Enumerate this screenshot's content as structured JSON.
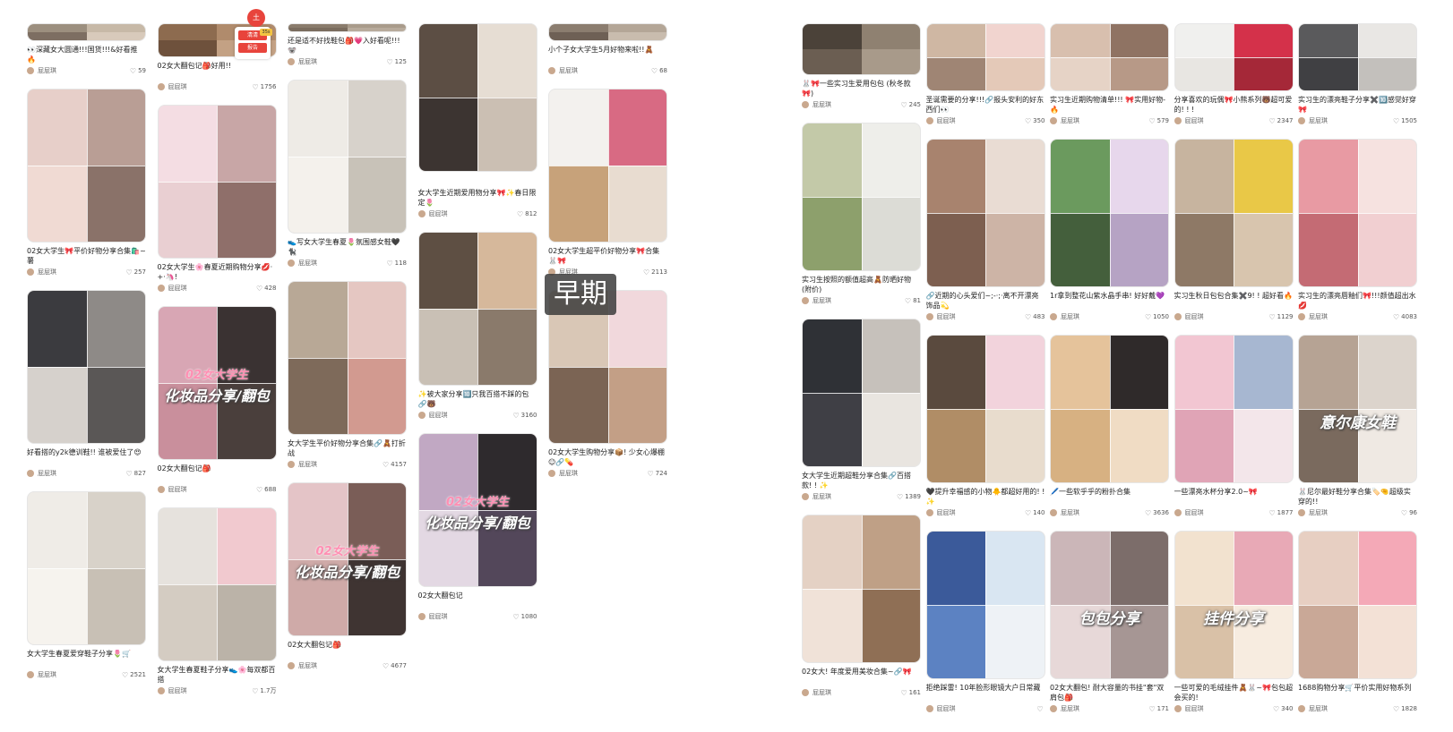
{
  "overlay_label": "早期",
  "floating_tools": {
    "fab": "土",
    "chip1": "清清",
    "chip2": "报告",
    "badge": "35s"
  },
  "colors": {
    "accent": "#e8443c",
    "overlay_bg": "#3c3c3c",
    "sticker_pink": "#ff8fb3"
  },
  "left_columns": [
    [
      {
        "title": "👀深藏女大圆通!!!国货!!!&好看推🔥",
        "author": "屁屁琪",
        "likes": "59",
        "h": 20,
        "tone": [
          "#9c8f7f",
          "#c7b9a7",
          "#7d6e62",
          "#d8cabb"
        ]
      },
      {
        "title": "02女大学生🎀平价好物分享合集🛍️~薯",
        "author": "屁屁琪",
        "likes": "257",
        "h": 172,
        "tone": [
          "#e7cfc9",
          "#b99e95",
          "#f0dad3",
          "#8a7269"
        ]
      },
      {
        "title": "好看搭的y2k德训鞋!! 谁被爱住了😍",
        "author": "屁屁琪",
        "likes": "827",
        "h": 172,
        "tone": [
          "#3b3b3f",
          "#8e8a87",
          "#d6d1cc",
          "#5a5756"
        ]
      },
      {
        "title": "女大学生春夏爱穿鞋子分享🌷🛒",
        "author": "屁屁琪",
        "likes": "2521",
        "h": 172,
        "tone": [
          "#efece7",
          "#d8d2c9",
          "#f6f3ee",
          "#c8c0b5"
        ]
      }
    ],
    [
      {
        "title": "02女大翻包记🎒好用!!",
        "author": "屁屁琪",
        "likes": "1756",
        "h": 38,
        "tone": [
          "#8d6b4f",
          "#b08b6c",
          "#6e513c",
          "#c3a184"
        ]
      },
      {
        "title": "02女大学生🌸春夏近期购物分享💋·+·🦄!",
        "author": "屁屁琪",
        "likes": "428",
        "h": 172,
        "tone": [
          "#f4dde3",
          "#c8a6a6",
          "#e9cfd2",
          "#8f6f6a"
        ]
      },
      {
        "title": "02女大翻包记🎒",
        "author": "屁屁琪",
        "likes": "688",
        "h": 172,
        "tone": [
          "#d8a6b4",
          "#3a3232",
          "#c98f9c",
          "#4a3f3c"
        ],
        "sticker": "02女大学生",
        "big": "化妆品分享/翻包"
      },
      {
        "title": "女大学生春夏鞋子分享👟🌸每双都百搭",
        "author": "屁屁琪",
        "likes": "1.7万",
        "h": 172,
        "tone": [
          "#e6e2dd",
          "#f1c9cf",
          "#d4ccc2",
          "#bbb3a8"
        ]
      }
    ],
    [
      {
        "title": "还是适不好找鞋包🎒💗入好看呢!!!🐨",
        "author": "屁屁琪",
        "likes": "125",
        "h": 10,
        "tone": [
          "#8a7c6c",
          "#a99b8b",
          "#7a6c5e",
          "#b8ab9c"
        ]
      },
      {
        "title": "👟写女大学生春夏🌷氛围感女鞋🖤🐈‍⬛",
        "author": "屁屁琪",
        "likes": "118",
        "h": 172,
        "tone": [
          "#eeebe6",
          "#d7d2cb",
          "#f4f1ec",
          "#c8c2b8"
        ]
      },
      {
        "title": "女大学生平价好物分享合集🔗🧸打折战",
        "author": "屁屁琪",
        "likes": "4157",
        "h": 172,
        "tone": [
          "#b8a896",
          "#e5c7c2",
          "#7e6a5a",
          "#d29a90"
        ]
      },
      {
        "title": "02女大翻包记🎒",
        "author": "屁屁琪",
        "likes": "4677",
        "h": 172,
        "tone": [
          "#e4c4c7",
          "#7a5d57",
          "#cfaaa8",
          "#3f3432"
        ],
        "sticker": "02女大学生",
        "big": "化妆品分享/翻包"
      }
    ],
    [
      {
        "title": "",
        "author": "",
        "likes": "",
        "h": 166,
        "tone": [
          "#5c4e44",
          "#e6ddd3",
          "#3c3431",
          "#cbbfb3"
        ]
      },
      {
        "title": "女大学生近期爱用物分享🎀✨春日限定🌷",
        "author": "屁屁琪",
        "likes": "812",
        "h": 0,
        "tone": []
      },
      {
        "title": "✨被大家分享🔟只我百搭不踩的包🔗🐻",
        "author": "屁屁琪",
        "likes": "3160",
        "h": 172,
        "tone": [
          "#5e4f43",
          "#d6b89b",
          "#c9c0b5",
          "#8a7a6b"
        ]
      },
      {
        "title": "02女大翻包记",
        "author": "屁屁琪",
        "likes": "1080",
        "h": 172,
        "tone": [
          "#c1a8c3",
          "#2e2a2d",
          "#e3d8e3",
          "#53475a"
        ],
        "sticker": "02女大学生",
        "big": "化妆品分享/翻包"
      }
    ],
    [
      {
        "title": "小个子女大学生5月好物来啦!!🧸",
        "author": "屁屁琪",
        "likes": "68",
        "h": 20,
        "tone": [
          "#8b7d6f",
          "#b4a697",
          "#6e6055",
          "#c9bcae"
        ]
      },
      {
        "title": "02女大学生超平价好物分享🎀合集🐰🎀",
        "author": "屁屁琪",
        "likes": "2113",
        "h": 172,
        "tone": [
          "#f3f1ee",
          "#d86a83",
          "#c7a27a",
          "#e8dcd0"
        ]
      },
      {
        "title": "02女大学生购物分享📦! 少女心爆棚☺🔗💊",
        "author": "屁屁琪",
        "likes": "724",
        "h": 172,
        "tone": [
          "#d9c7b6",
          "#f1d8dc",
          "#7b6454",
          "#c39f86"
        ]
      }
    ]
  ],
  "right_columns": [
    [
      {
        "title": "🐰🎀一些实习生爱用包包 (秋冬款🎀)",
        "author": "屁屁琪",
        "likes": "245",
        "h": 58,
        "tone": [
          "#4b4239",
          "#8f8171",
          "#6b5e52",
          "#a89a8a"
        ]
      },
      {
        "title": "实习生按照的额值超高🧸防晒好物 (附价)",
        "author": "屁屁琪",
        "likes": "81",
        "h": 166,
        "tone": [
          "#c3c9a8",
          "#eeeeea",
          "#8da06c",
          "#dcdcd6"
        ]
      },
      {
        "title": "女大学生近期超鞋分享合集🔗百搭款! ! ✨",
        "author": "屁屁琪",
        "likes": "1389",
        "h": 166,
        "tone": [
          "#2f3136",
          "#c6c1bb",
          "#3f3f45",
          "#e9e5e0"
        ]
      },
      {
        "title": "02女大! 年度爱用美妆合集~🔗🎀",
        "author": "屁屁琪",
        "likes": "161",
        "h": 166,
        "tone": [
          "#e4d1c4",
          "#bfa086",
          "#f0e2d8",
          "#8f6f55"
        ]
      }
    ],
    [
      {
        "title": "圣诞需要的分享!!!🔗报头安利的好东西们👀",
        "author": "屁屁琪",
        "likes": "350",
        "h": 76,
        "tone": [
          "#cfb7a3",
          "#f1d4cf",
          "#9f8574",
          "#e4c9b8"
        ]
      },
      {
        "title": "🔗近期的心头爱们~;-·;·离不开漂亮饰品💫",
        "author": "屁屁琪",
        "likes": "483",
        "h": 166,
        "tone": [
          "#a8836e",
          "#e9dcd3",
          "#7d5f50",
          "#cdb4a6"
        ]
      },
      {
        "title": "🖤提升幸福感的小物🐥都超好用的! ! ✨",
        "author": "屁屁琪",
        "likes": "140",
        "h": 166,
        "tone": [
          "#5a4a3e",
          "#f2d3dc",
          "#b08d66",
          "#e8dccd"
        ]
      },
      {
        "title": "拒绝踩雷! 10年脸形眼镜大户日常藏",
        "author": "屁屁琪",
        "likes": "",
        "h": 166,
        "tone": [
          "#3b5a9a",
          "#d9e6f2",
          "#5c82c2",
          "#eef2f6"
        ]
      }
    ],
    [
      {
        "title": "实习生近期购物清单!!! 🎀实用好物-🔥",
        "author": "屁屁琪",
        "likes": "579",
        "h": 76,
        "tone": [
          "#d8bfae",
          "#8f7363",
          "#e6d3c6",
          "#b79987"
        ]
      },
      {
        "title": "1r拿到整花山紫水晶手串! 好好戴💜",
        "author": "屁屁琪",
        "likes": "1050",
        "h": 166,
        "tone": [
          "#6b9a5e",
          "#e7d7ec",
          "#445f3c",
          "#b6a3c4"
        ]
      },
      {
        "title": "🖊️一些软乎乎的粉扑合集",
        "author": "屁屁琪",
        "likes": "3636",
        "h": 166,
        "tone": [
          "#e5c39b",
          "#2f2a2a",
          "#d7b182",
          "#f0dcc4"
        ]
      },
      {
        "title": "02女大翻包! 耐大容量的书挂\"套\"双肩包🎒",
        "author": "屁屁琪",
        "likes": "171",
        "h": 166,
        "tone": [
          "#cbb6b8",
          "#7c6d6a",
          "#e7d8d8",
          "#a69694"
        ],
        "big": "包包分享"
      }
    ],
    [
      {
        "title": "分享喜欢的玩偶🎀小熊系列🐻超可爱的! ! !",
        "author": "屁屁琪",
        "likes": "2347",
        "h": 76,
        "tone": [
          "#f0f0ee",
          "#d4314a",
          "#e8e6e2",
          "#a52838"
        ]
      },
      {
        "title": "实习生秋日包包合集✖️9! ! 超好看🔥",
        "author": "屁屁琪",
        "likes": "1129",
        "h": 166,
        "tone": [
          "#c7b49f",
          "#e9c847",
          "#8e7966",
          "#d8c5ae"
        ]
      },
      {
        "title": "一些漂亮水杯分享2.0~🎀",
        "author": "屁屁琪",
        "likes": "1877",
        "h": 166,
        "tone": [
          "#f2c6d2",
          "#a7b7d1",
          "#e0a4b6",
          "#f3e6ea"
        ]
      },
      {
        "title": "一些可爱的毛绒挂件🧸🐰~🎀包包超会买的!",
        "author": "屁屁琪",
        "likes": "340",
        "h": 166,
        "tone": [
          "#f2e2cf",
          "#e8a9b6",
          "#d9c1a7",
          "#f7ece0"
        ],
        "big": "挂件分享"
      }
    ],
    [
      {
        "title": "实习生的漂亮鞋子分享✖️🔟感觉好穿🎀",
        "author": "屁屁琪",
        "likes": "1505",
        "h": 76,
        "tone": [
          "#5a5a5c",
          "#e9e7e4",
          "#404043",
          "#c3c0bc"
        ]
      },
      {
        "title": "实习生的漂亮唇釉们🎀!!!颜值超出水💋",
        "author": "屁屁琪",
        "likes": "4083",
        "h": 166,
        "tone": [
          "#e89aa3",
          "#f6e2e0",
          "#c46b74",
          "#f1cfd1"
        ]
      },
      {
        "title": "🐰尼尔最好鞋分享合集🏷️🤏超级实穿的!!",
        "author": "屁屁琪",
        "likes": "96",
        "h": 166,
        "tone": [
          "#b6a394",
          "#dcd4cc",
          "#7a6a5e",
          "#efe9e3"
        ],
        "big": "意尔康女鞋"
      },
      {
        "title": "1688购物分享🛒平价实用好物系列",
        "author": "屁屁琪",
        "likes": "1828",
        "h": 166,
        "tone": [
          "#e7cfc2",
          "#f4a9b7",
          "#c9a897",
          "#f3e1d6"
        ]
      }
    ]
  ]
}
